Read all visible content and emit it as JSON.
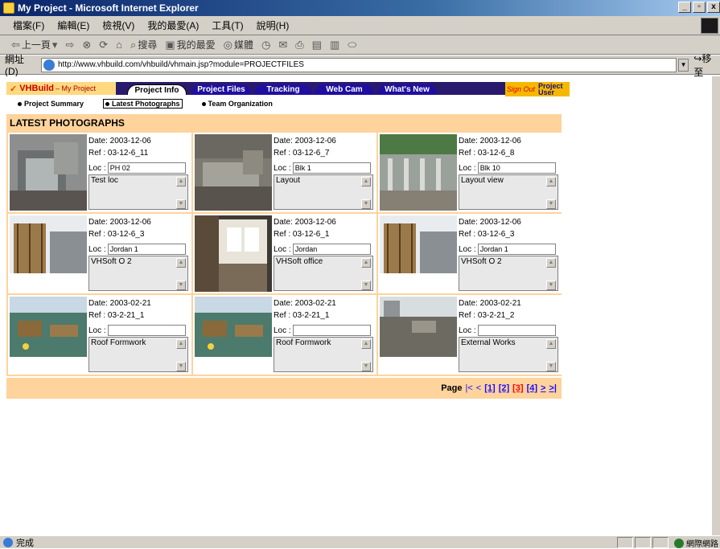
{
  "window": {
    "title": "My Project - Microsoft Internet Explorer",
    "buttons": [
      "_",
      "▫",
      "x"
    ]
  },
  "menu": {
    "items": [
      "檔案(F)",
      "編輯(E)",
      "檢視(V)",
      "我的最愛(A)",
      "工具(T)",
      "說明(H)"
    ]
  },
  "toolbar": {
    "back_label": "上一頁",
    "search_label": "搜尋",
    "favorites_label": "我的最愛",
    "media_label": "媒體"
  },
  "address": {
    "label": "網址(D)",
    "url": "http://www.vhbuild.com/vhbuild/vhmain.jsp?module=PROJECTFILES",
    "go_label": "移至"
  },
  "app": {
    "brand": "VHBuild",
    "brand_sub": "– My Project",
    "tabs": [
      "Project Info",
      "Project Files",
      "Tracking",
      "Web Cam",
      "What's New"
    ],
    "active_tab": "Project Info",
    "signout": "Sign Out",
    "links": [
      "Project",
      "User"
    ],
    "subnav": [
      "Project Summary",
      "Latest Photographs",
      "Team Organization"
    ],
    "active_subnav": "Latest Photographs"
  },
  "section_title": "LATEST PHOTOGRAPHS",
  "photos": [
    {
      "date": "Date: 2003-12-06",
      "ref": "Ref : 03-12-6_11",
      "loc_label": "Loc :",
      "loc": "PH 02",
      "desc": "Test loc",
      "scene": "rubble"
    },
    {
      "date": "Date: 2003-12-06",
      "ref": "Ref : 03-12-6_7",
      "loc_label": "Loc :",
      "loc": "Blk 1",
      "desc": "Layout",
      "scene": "rubble2"
    },
    {
      "date": "Date: 2003-12-06",
      "ref": "Ref : 03-12-6_8",
      "loc_label": "Loc :",
      "loc": "Blk 10",
      "desc": "Layout view",
      "scene": "wall"
    },
    {
      "date": "Date: 2003-12-06",
      "ref": "Ref : 03-12-6_3",
      "loc_label": "Loc :",
      "loc": "Jordan 1",
      "desc": "VHSoft O 2",
      "scene": "scaffold"
    },
    {
      "date": "Date: 2003-12-06",
      "ref": "Ref : 03-12-6_1",
      "loc_label": "Loc :",
      "loc": "Jordan",
      "desc": "VHSoft office",
      "scene": "interior"
    },
    {
      "date": "Date: 2003-12-06",
      "ref": "Ref : 03-12-6_3",
      "loc_label": "Loc :",
      "loc": "Jordan 1",
      "desc": "VHSoft O 2",
      "scene": "scaffold"
    },
    {
      "date": "Date: 2003-02-21",
      "ref": "Ref : 03-2-21_1",
      "loc_label": "Loc :",
      "loc": "",
      "desc": "Roof Formwork",
      "scene": "formwork"
    },
    {
      "date": "Date: 2003-02-21",
      "ref": "Ref : 03-2-21_1",
      "loc_label": "Loc :",
      "loc": "",
      "desc": "Roof Formwork",
      "scene": "formwork"
    },
    {
      "date": "Date: 2003-02-21",
      "ref": "Ref : 03-2-21_2",
      "loc_label": "Loc :",
      "loc": "",
      "desc": "External Works",
      "scene": "external"
    }
  ],
  "pager": {
    "label": "Page",
    "first": "|<",
    "prev": "<",
    "pages": [
      "[1]",
      "[2]",
      "[3]",
      "[4]"
    ],
    "current": 3,
    "next": ">",
    "last": ">|"
  },
  "status": {
    "text": "完成",
    "zone": "網際網路"
  },
  "colors": {
    "accent": "#ffd39c",
    "tab_blue": "#1f0fa0",
    "header_navy": "#2a1a6e",
    "brand_bg": "#ffd980"
  }
}
